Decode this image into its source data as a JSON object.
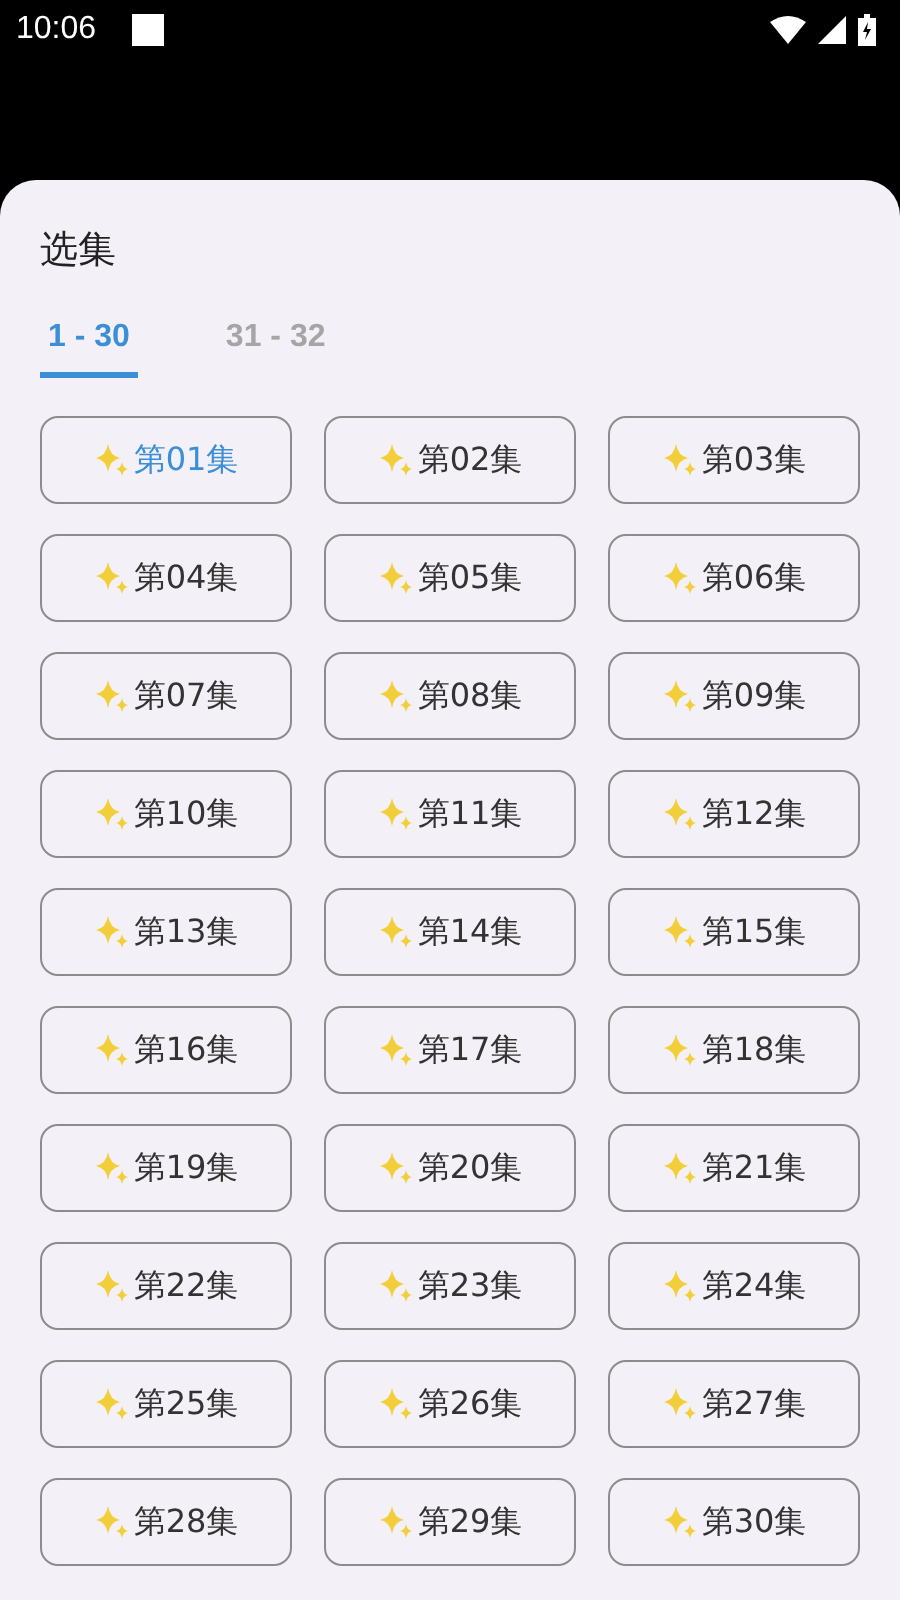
{
  "status_bar": {
    "time": "10:06"
  },
  "sheet": {
    "title": "选集"
  },
  "tabs": [
    {
      "label": "1 - 30",
      "selected": true
    },
    {
      "label": "31 - 32",
      "selected": false
    }
  ],
  "episodes": [
    {
      "label": "第01集",
      "selected": true
    },
    {
      "label": "第02集",
      "selected": false
    },
    {
      "label": "第03集",
      "selected": false
    },
    {
      "label": "第04集",
      "selected": false
    },
    {
      "label": "第05集",
      "selected": false
    },
    {
      "label": "第06集",
      "selected": false
    },
    {
      "label": "第07集",
      "selected": false
    },
    {
      "label": "第08集",
      "selected": false
    },
    {
      "label": "第09集",
      "selected": false
    },
    {
      "label": "第10集",
      "selected": false
    },
    {
      "label": "第11集",
      "selected": false
    },
    {
      "label": "第12集",
      "selected": false
    },
    {
      "label": "第13集",
      "selected": false
    },
    {
      "label": "第14集",
      "selected": false
    },
    {
      "label": "第15集",
      "selected": false
    },
    {
      "label": "第16集",
      "selected": false
    },
    {
      "label": "第17集",
      "selected": false
    },
    {
      "label": "第18集",
      "selected": false
    },
    {
      "label": "第19集",
      "selected": false
    },
    {
      "label": "第20集",
      "selected": false
    },
    {
      "label": "第21集",
      "selected": false
    },
    {
      "label": "第22集",
      "selected": false
    },
    {
      "label": "第23集",
      "selected": false
    },
    {
      "label": "第24集",
      "selected": false
    },
    {
      "label": "第25集",
      "selected": false
    },
    {
      "label": "第26集",
      "selected": false
    },
    {
      "label": "第27集",
      "selected": false
    },
    {
      "label": "第28集",
      "selected": false
    },
    {
      "label": "第29集",
      "selected": false
    },
    {
      "label": "第30集",
      "selected": false
    }
  ]
}
